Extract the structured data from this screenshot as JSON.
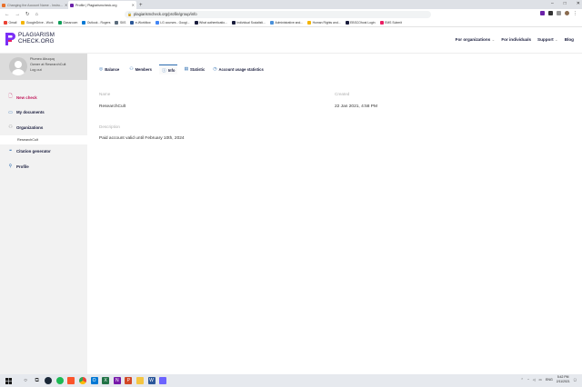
{
  "browser": {
    "tabs": [
      {
        "title": "Changing the Account Name - Instru...",
        "active": false,
        "color": "#e8702a"
      },
      {
        "title": "Profile | Plagiarismcheck.org",
        "active": true,
        "color": "#6b21a8"
      }
    ],
    "url": "plagiarismcheck.org/profile/group/info",
    "bookmarks": [
      {
        "label": "Gmail",
        "color": "#ea4335"
      },
      {
        "label": "GoogleDrive - Work",
        "color": "#f4b400"
      },
      {
        "label": "Classroom",
        "color": "#0f9d58"
      },
      {
        "label": "Outlook - Rogers",
        "color": "#0078d4"
      },
      {
        "label": "SIIS",
        "color": "#5a6b7b"
      },
      {
        "label": "e-Workflow",
        "color": "#2b5797"
      },
      {
        "label": "LG courses - Googl...",
        "color": "#4285f4"
      },
      {
        "label": "What authenticatio...",
        "color": "#1a1d3d"
      },
      {
        "label": "Individual Socialisti...",
        "color": "#1a1d3d"
      },
      {
        "label": "Administrative and...",
        "color": "#4a90d9"
      },
      {
        "label": "Human Rights and...",
        "color": "#f4b400"
      },
      {
        "label": "EBSCOhost Login",
        "color": "#1a1d3d"
      },
      {
        "label": "EMS Submit",
        "color": "#e91e63"
      }
    ]
  },
  "site": {
    "logo_line1": "PLAGIARISM",
    "logo_line2": "CHECK.ORG",
    "nav": [
      {
        "label": "For organizations",
        "has_caret": true
      },
      {
        "label": "For individuals",
        "has_caret": false
      },
      {
        "label": "Support",
        "has_caret": true
      },
      {
        "label": "Blog",
        "has_caret": false
      }
    ]
  },
  "sidebar": {
    "user_name": "Plumeo Abuquq",
    "user_role": "Owner at ResearchCult",
    "logout": "Log out",
    "items": [
      {
        "label": "New check",
        "icon": "doc-plus-icon"
      },
      {
        "label": "My documents",
        "icon": "folder-icon"
      },
      {
        "label": "Organizations",
        "icon": "people-icon"
      },
      {
        "label": "ResearchCult",
        "icon": ""
      },
      {
        "label": "Citation generator",
        "icon": "quote-icon"
      },
      {
        "label": "Profile",
        "icon": "user-icon"
      }
    ]
  },
  "content": {
    "tabs": [
      {
        "label": "Balance",
        "icon": "coin-icon",
        "active": false
      },
      {
        "label": "Members",
        "icon": "people-icon",
        "active": false
      },
      {
        "label": "Info",
        "icon": "info-icon",
        "active": true
      },
      {
        "label": "Statistic",
        "icon": "stats-icon",
        "active": false
      },
      {
        "label": "Account usage statistics",
        "icon": "clock-icon",
        "active": false
      }
    ],
    "name_label": "Name",
    "name_value": "ResearchCult",
    "created_label": "Created",
    "created_value": "22 Jan 2021, 4:58 PM",
    "description_label": "Description",
    "description_value": "Paid account valid until February 10th, 2024"
  },
  "taskbar": {
    "time": "5:42 PM",
    "date": "2/11/2021",
    "lang": "ENG"
  }
}
